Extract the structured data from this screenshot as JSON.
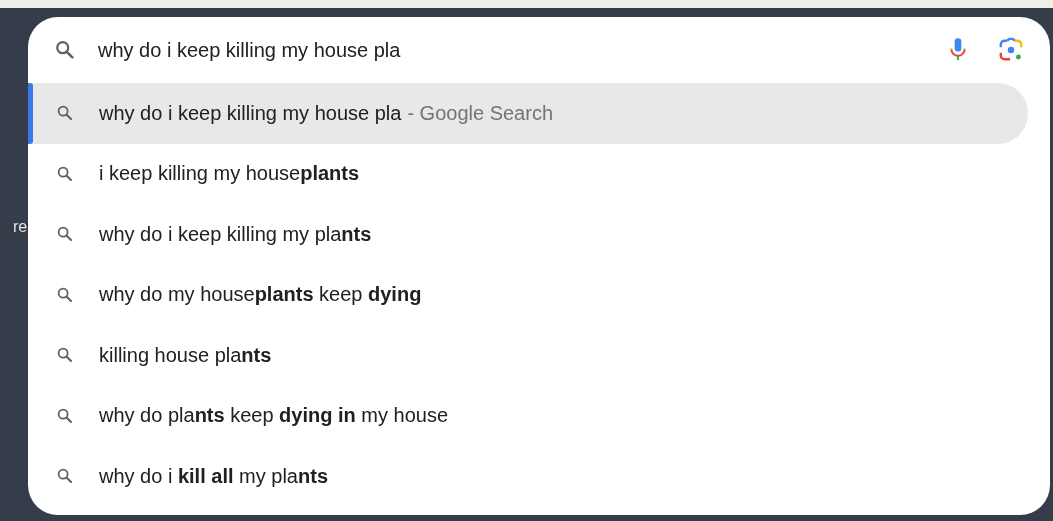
{
  "background_text": "re",
  "search": {
    "value": "why do i keep killing my house pla"
  },
  "suggestions": [
    {
      "text": "why do i keep killing my house pla",
      "suffix": "- Google Search",
      "selected": true
    },
    {
      "text": "i keep killing my house**plants**",
      "selected": false
    },
    {
      "text": "why do i keep killing my pla**nts**",
      "selected": false
    },
    {
      "text": "why do my house**plants** keep **dying**",
      "selected": false
    },
    {
      "text": "killing house pla**nts**",
      "selected": false
    },
    {
      "text": "why do pla**nts** keep **dying** **in** my house",
      "selected": false
    },
    {
      "text": "why do i **kill all** my pla**nts**",
      "selected": false
    }
  ]
}
